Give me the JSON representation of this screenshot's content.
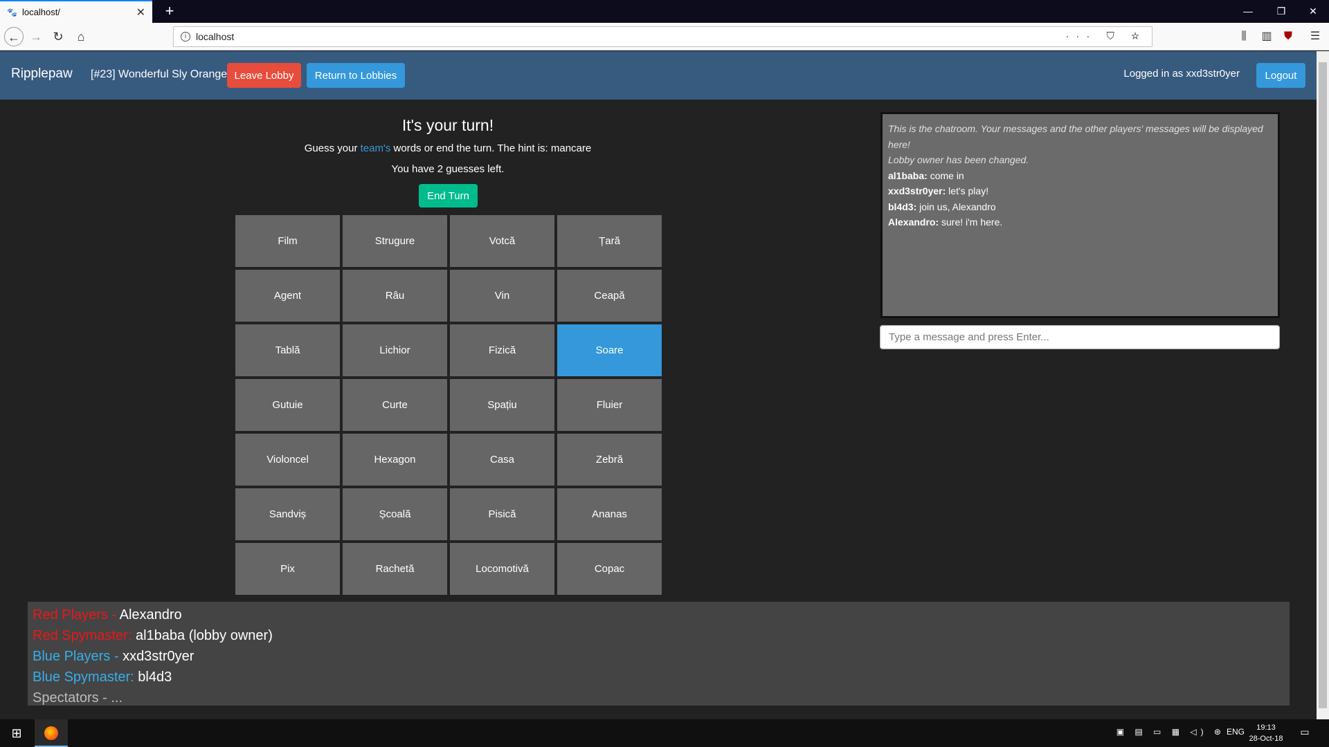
{
  "browser": {
    "tab_title": "localhost/",
    "tab_close": "✕",
    "new_tab": "+",
    "url": "localhost",
    "url_actions": "··· ⛉ ☆",
    "minimize": "—",
    "restore": "❐",
    "close": "✕"
  },
  "app": {
    "brand": "Ripplepaw",
    "lobby_name": "[#23] Wonderful Sly Orange",
    "leave_label": "Leave Lobby",
    "return_label": "Return to Lobbies",
    "logged_in": "Logged in as xxd3str0yer",
    "logout_label": "Logout"
  },
  "game": {
    "turn_title": "It's your turn!",
    "hint_prefix": "Guess your ",
    "hint_teams": "team's",
    "hint_suffix": " words or end the turn. The hint is: mancare",
    "guesses_left": "You have 2 guesses left.",
    "end_turn_label": "End Turn",
    "cards": [
      "Film",
      "Strugure",
      "Votcă",
      "Țară",
      "Agent",
      "Râu",
      "Vin",
      "Ceapă",
      "Tablă",
      "Lichior",
      "Fizică",
      "Soare",
      "Gutuie",
      "Curte",
      "Spațiu",
      "Fluier",
      "Violoncel",
      "Hexagon",
      "Casa",
      "Zebră",
      "Sandviș",
      "Școală",
      "Pisică",
      "Ananas",
      "Pix",
      "Rachetă",
      "Locomotivă",
      "Copac"
    ],
    "selected_card": "Soare"
  },
  "chat": {
    "system_messages": [
      "This is the chatroom. Your messages and the other players' messages will be displayed here!",
      "Lobby owner has been changed."
    ],
    "messages": [
      {
        "user": "al1baba:",
        "text": " come in"
      },
      {
        "user": "xxd3str0yer:",
        "text": " let's play!"
      },
      {
        "user": "bl4d3:",
        "text": " join us, Alexandro"
      },
      {
        "user": "Alexandro:",
        "text": " sure! i'm here."
      }
    ],
    "input_placeholder": "Type a message and press Enter..."
  },
  "players": {
    "red_players_label": "Red Players - ",
    "red_players": "Alexandro",
    "red_spymaster_label": "Red Spymaster: ",
    "red_spymaster": "al1baba (lobby owner)",
    "blue_players_label": "Blue Players - ",
    "blue_players": "xxd3str0yer",
    "blue_spymaster_label": "Blue Spymaster: ",
    "blue_spymaster": "bl4d3",
    "spectators": "Spectators - ..."
  },
  "taskbar": {
    "language": "ENG",
    "time": "19:13",
    "date": "28-Oct-18"
  },
  "colors": {
    "navbar": "#375a7f",
    "danger": "#e74c3c",
    "primary": "#3498db",
    "success": "#00bc8c",
    "card": "#666666",
    "red_team": "#e8181b",
    "blue_team": "#36aeea"
  }
}
